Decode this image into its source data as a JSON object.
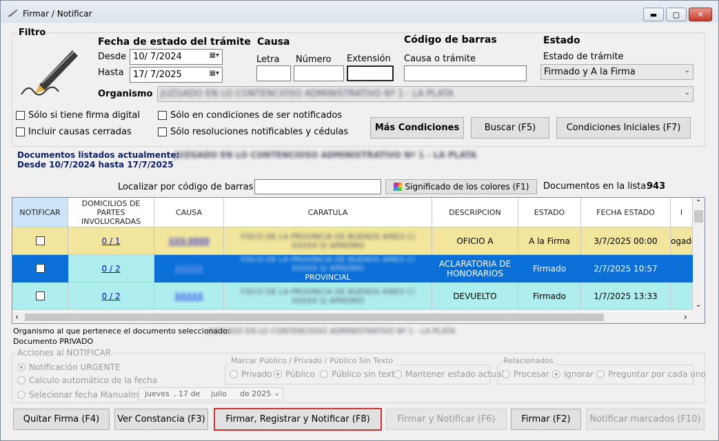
{
  "window": {
    "title": "Firmar / Notificar"
  },
  "filter": {
    "title": "Filtro",
    "fecha_title": "Fecha de estado del trámite",
    "desde_label": "Desde",
    "desde_value": "10/  7/2024",
    "hasta_label": "Hasta",
    "hasta_value": "17/  7/2025",
    "causa_title": "Causa",
    "letra_label": "Letra",
    "numero_label": "Número",
    "extension_label": "Extensión",
    "barcode_title": "Código de barras",
    "barcode_label": "Causa o trámite",
    "estado_title": "Estado",
    "estado_tramite_label": "Estado de trámite",
    "estado_value": "Firmado y A la Firma",
    "organismo_label": "Organismo",
    "organismo_value": "JUZGADO EN LO CONTENCIOSO ADMINISTRATIVO Nº 1 - LA PLATA",
    "checks": [
      {
        "label": "Sólo si tiene firma digital"
      },
      {
        "label": "Incluir causas cerradas"
      },
      {
        "label": "Sólo en condiciones de ser notificados"
      },
      {
        "label": "Sólo resoluciones notificables y cédulas"
      }
    ],
    "btn_mas": "Más Condiciones",
    "btn_buscar": "Buscar (F5)",
    "btn_iniciales": "Condiciones Iniciales (F7)"
  },
  "listing": {
    "line1_label": "Documentos listados actualmente:",
    "line1_value": "JUZGADO EN LO CONTENCIOSO ADMINISTRATIVO Nº 1 - LA PLATA",
    "line2": "Desde 10/7/2024 hasta 17/7/2025",
    "localizar_label": "Localizar por código de barras",
    "colores_btn": "Significado de los colores (F1)",
    "count_label": "Documentos en la lista:",
    "count_value": "943"
  },
  "grid": {
    "headers": [
      "NOTIFICAR",
      "DOMICILIOS DE PARTES INVOLUCRADAS",
      "CAUSA",
      "CARATULA",
      "DESCRIPCION",
      "ESTADO",
      "FECHA ESTADO",
      "I"
    ],
    "rows": [
      {
        "domicilios": "0 / 1",
        "causa": "XXX-9999",
        "caratula": "FISCO DE LA PROVINCIA DE BUENOS AIRES C/ XXXXX S/ APREMIO",
        "descripcion": "OFICIO A",
        "estado": "A la Firma",
        "fecha": "3/7/2025 00:00",
        "extra": "ogado",
        "color": "#f2e59c"
      },
      {
        "domicilios": "0 / 2",
        "causa": "XXXXX",
        "caratula": "FISCO DE LA PROVINCIA DE BUENOS AIRES C/ XXXXX S/ APREMIO",
        "caratula_tail": "PROVINCIAL",
        "descripcion": "ACLARATORIA DE HONORARIOS",
        "estado": "Firmado",
        "fecha": "2/7/2025 10:57",
        "extra": "",
        "color": "#0a6fd6"
      },
      {
        "domicilios": "0 / 2",
        "causa": "XXXXX",
        "caratula": "FISCO DE LA PROVINCIA DE BUENOS AIRES C/ XXXXX S/ APREMIO",
        "descripcion": "DEVUELTO",
        "estado": "Firmado",
        "fecha": "1/7/2025 13:33",
        "extra": "",
        "color": "#aeeeee"
      }
    ]
  },
  "selected": {
    "organismo_label": "Organismo al que pertenece el documento seleccionado:",
    "organismo_value": "JUZGADO EN LO CONTENCIOSO ADMINISTRATIVO Nº 1 - LA PLATA",
    "privado": "Documento PRIVADO"
  },
  "acciones": {
    "title": "Acciones al NOTIFICAR",
    "urgente": "Notificación URGENTE",
    "calculo": "Calculo automático de la fecha",
    "manual": "Selecionar fecha Manualmente",
    "fecha_day": "jueves",
    "fecha_num": ", 17 de",
    "fecha_month": "julio",
    "fecha_year": "de 2025",
    "marcar_title": "Marcar Público / Privado / Público Sin Texto",
    "privado": "Privado",
    "publico": "Público",
    "publico_sin": "Público sin texto",
    "mantener": "Mantener estado actual",
    "relacionados_title": "Relacionados",
    "procesar": "Procesar",
    "ignorar": "Ignorar",
    "preguntar": "Preguntar por cada uno"
  },
  "buttons": {
    "quitar": "Quitar Firma (F4)",
    "constancia": "Ver Constancia (F3)",
    "firmar_registrar": "Firmar, Registrar y Notificar (F8)",
    "firmar_notificar": "Firmar  y Notificar (F6)",
    "firmar": "Firmar (F2)",
    "notificar_marcados": "Notificar marcados (F10)"
  }
}
